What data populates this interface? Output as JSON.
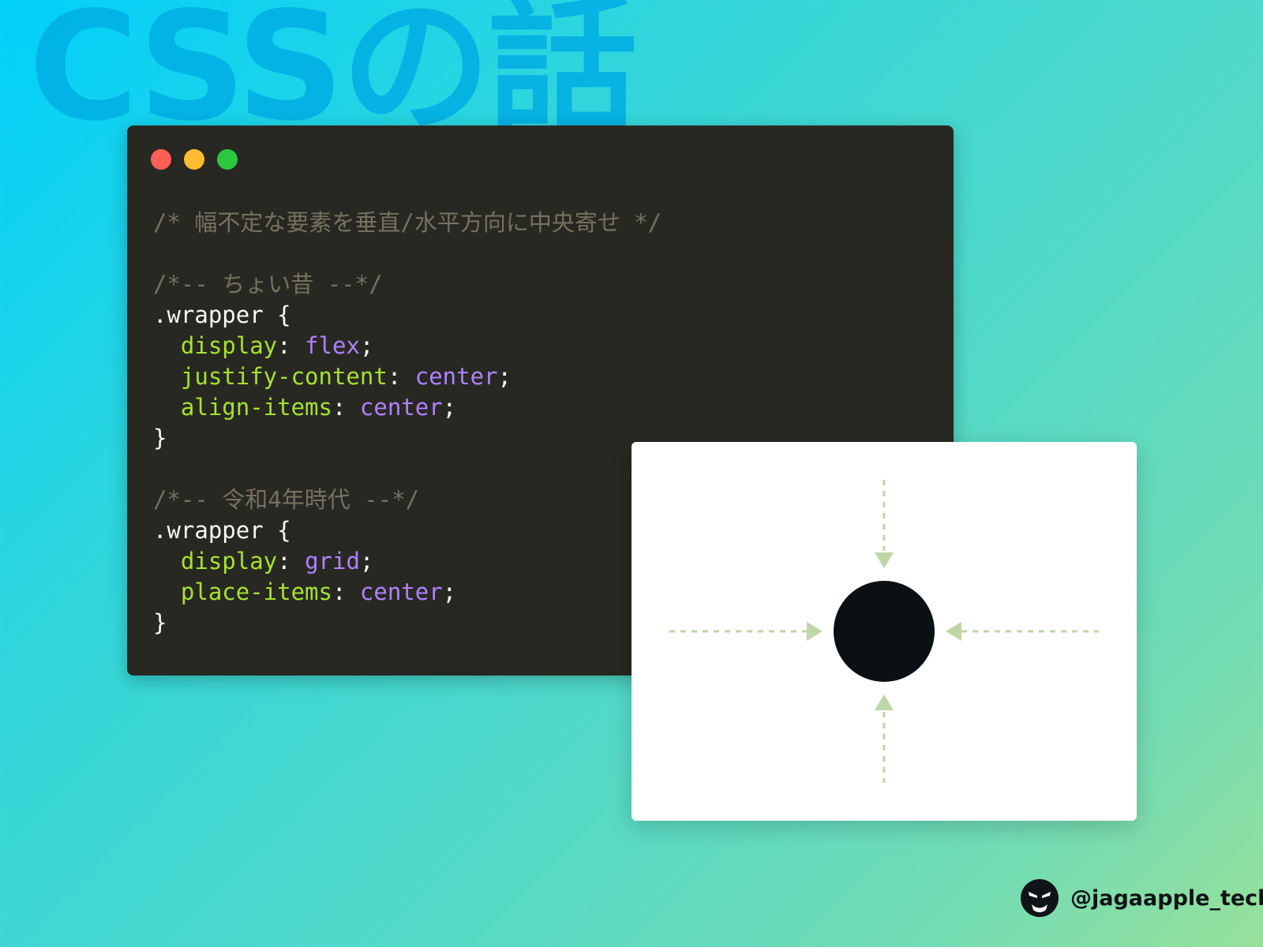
{
  "title": "CSSの話",
  "code": {
    "comment_main": "/* 幅不定な要素を垂直/水平方向に中央寄せ */",
    "comment_old": "/*-- ちょい昔 --*/",
    "comment_new": "/*-- 令和4年時代 --*/",
    "selector": ".wrapper",
    "brace_open": " {",
    "brace_close": "}",
    "colon": ": ",
    "semicolon": ";",
    "prop_display": "display",
    "val_flex": "flex",
    "prop_justify": "justify-content",
    "val_center": "center",
    "prop_align": "align-items",
    "val_grid": "grid",
    "prop_place": "place-items"
  },
  "colors": {
    "comment": "#75715e",
    "property": "#a6e22e",
    "value": "#ae81ff",
    "arrow": "#bfd6a6",
    "dot": "#0a1014"
  },
  "author": {
    "handle": "@jagaapple_tech",
    "icon": "ninja-avatar-icon"
  }
}
